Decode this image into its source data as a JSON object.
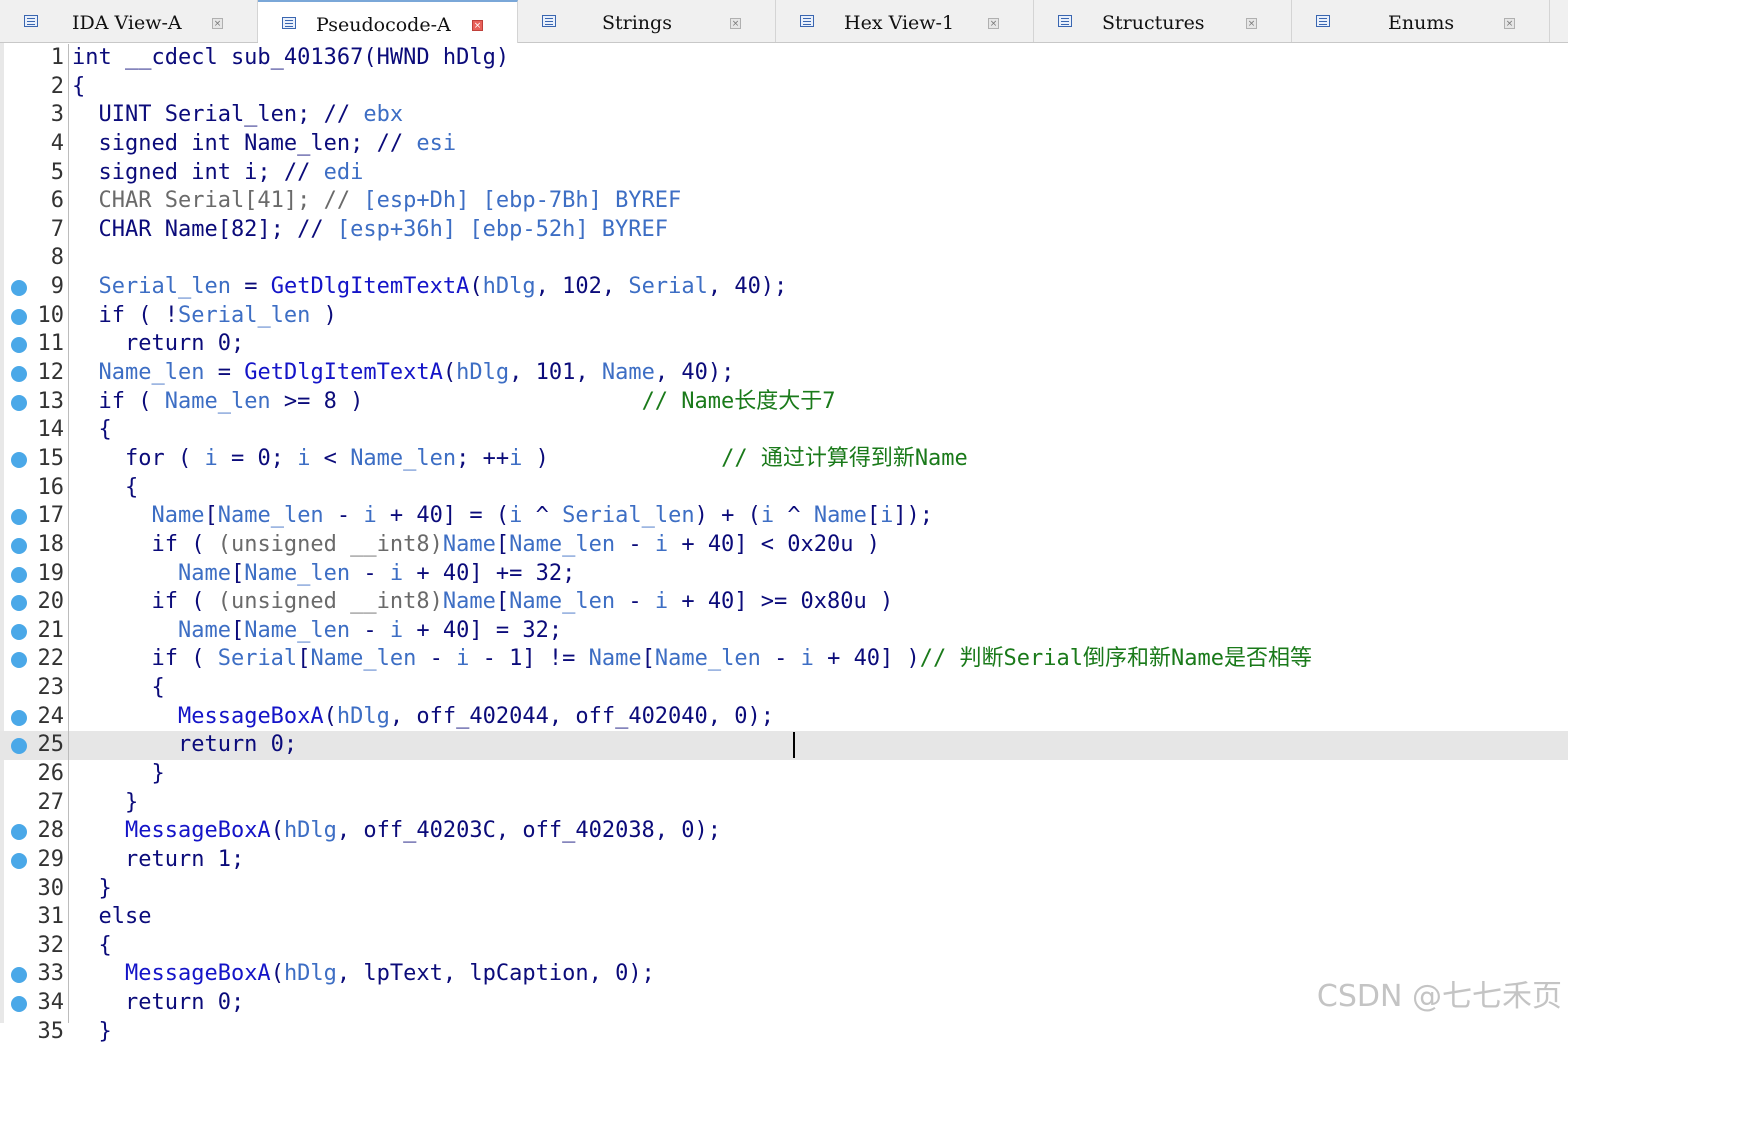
{
  "tabs": [
    {
      "label": "IDA View-A",
      "icon": "ida-view-icon",
      "active": false
    },
    {
      "label": "Pseudocode-A",
      "icon": "pseudocode-icon",
      "active": true
    },
    {
      "label": "Strings",
      "icon": "strings-icon",
      "active": false
    },
    {
      "label": "Hex View-1",
      "icon": "hex-view-icon",
      "active": false
    },
    {
      "label": "Structures",
      "icon": "structures-icon",
      "active": false
    },
    {
      "label": "Enums",
      "icon": "enums-icon",
      "active": false
    }
  ],
  "close_glyph": "×",
  "breakpoint_lines": [
    9,
    10,
    11,
    12,
    13,
    15,
    17,
    18,
    19,
    20,
    21,
    22,
    24,
    25,
    28,
    29,
    33,
    34
  ],
  "highlight_line": 25,
  "lines": [
    {
      "n": "1",
      "segs": [
        {
          "t": "int __cdecl sub_401367(HWND hDlg)",
          "k": ""
        }
      ]
    },
    {
      "n": "2",
      "segs": [
        {
          "t": "{",
          "k": ""
        }
      ]
    },
    {
      "n": "3",
      "segs": [
        {
          "t": "  UINT Serial_len; // ",
          "k": ""
        },
        {
          "t": "ebx",
          "k": "v"
        }
      ]
    },
    {
      "n": "4",
      "segs": [
        {
          "t": "  signed int Name_len; // ",
          "k": ""
        },
        {
          "t": "esi",
          "k": "v"
        }
      ]
    },
    {
      "n": "5",
      "segs": [
        {
          "t": "  signed int i; // ",
          "k": ""
        },
        {
          "t": "edi",
          "k": "v"
        }
      ]
    },
    {
      "n": "6",
      "segs": [
        {
          "t": "  CHAR Serial[41]; // ",
          "k": "d"
        },
        {
          "t": "[esp+Dh] [ebp-7Bh] BYREF",
          "k": "v"
        }
      ]
    },
    {
      "n": "7",
      "segs": [
        {
          "t": "  CHAR Name[82]; // ",
          "k": ""
        },
        {
          "t": "[esp+36h] [ebp-52h] BYREF",
          "k": "v"
        }
      ]
    },
    {
      "n": "8",
      "segs": [
        {
          "t": "",
          "k": ""
        }
      ]
    },
    {
      "n": "9",
      "segs": [
        {
          "t": "  ",
          "k": ""
        },
        {
          "t": "Serial_len",
          "k": "v"
        },
        {
          "t": " = ",
          "k": ""
        },
        {
          "t": "GetDlgItemTextA",
          "k": "f"
        },
        {
          "t": "(",
          "k": ""
        },
        {
          "t": "hDlg",
          "k": "v"
        },
        {
          "t": ", 102, ",
          "k": ""
        },
        {
          "t": "Serial",
          "k": "v"
        },
        {
          "t": ", 40);",
          "k": ""
        }
      ]
    },
    {
      "n": "10",
      "segs": [
        {
          "t": "  if ( !",
          "k": ""
        },
        {
          "t": "Serial_len",
          "k": "v"
        },
        {
          "t": " )",
          "k": ""
        }
      ]
    },
    {
      "n": "11",
      "segs": [
        {
          "t": "    return 0;",
          "k": ""
        }
      ]
    },
    {
      "n": "12",
      "segs": [
        {
          "t": "  ",
          "k": ""
        },
        {
          "t": "Name_len",
          "k": "v"
        },
        {
          "t": " = ",
          "k": ""
        },
        {
          "t": "GetDlgItemTextA",
          "k": "f"
        },
        {
          "t": "(",
          "k": ""
        },
        {
          "t": "hDlg",
          "k": "v"
        },
        {
          "t": ", 101, ",
          "k": ""
        },
        {
          "t": "Name",
          "k": "v"
        },
        {
          "t": ", 40);",
          "k": ""
        }
      ]
    },
    {
      "n": "13",
      "segs": [
        {
          "t": "  if ( ",
          "k": ""
        },
        {
          "t": "Name_len",
          "k": "v"
        },
        {
          "t": " >= 8 )                     ",
          "k": ""
        },
        {
          "t": "// Name长度大于7",
          "k": "c"
        }
      ]
    },
    {
      "n": "14",
      "segs": [
        {
          "t": "  {",
          "k": ""
        }
      ]
    },
    {
      "n": "15",
      "segs": [
        {
          "t": "    for ( ",
          "k": ""
        },
        {
          "t": "i",
          "k": "v"
        },
        {
          "t": " = 0; ",
          "k": ""
        },
        {
          "t": "i",
          "k": "v"
        },
        {
          "t": " < ",
          "k": ""
        },
        {
          "t": "Name_len",
          "k": "v"
        },
        {
          "t": "; ++",
          "k": ""
        },
        {
          "t": "i",
          "k": "v"
        },
        {
          "t": " )             ",
          "k": ""
        },
        {
          "t": "// 通过计算得到新Name",
          "k": "c"
        }
      ]
    },
    {
      "n": "16",
      "segs": [
        {
          "t": "    {",
          "k": ""
        }
      ]
    },
    {
      "n": "17",
      "segs": [
        {
          "t": "      ",
          "k": ""
        },
        {
          "t": "Name",
          "k": "v"
        },
        {
          "t": "[",
          "k": ""
        },
        {
          "t": "Name_len",
          "k": "v"
        },
        {
          "t": " - ",
          "k": ""
        },
        {
          "t": "i",
          "k": "v"
        },
        {
          "t": " + 40] = (",
          "k": ""
        },
        {
          "t": "i",
          "k": "v"
        },
        {
          "t": " ^ ",
          "k": ""
        },
        {
          "t": "Serial_len",
          "k": "v"
        },
        {
          "t": ") + (",
          "k": ""
        },
        {
          "t": "i",
          "k": "v"
        },
        {
          "t": " ^ ",
          "k": ""
        },
        {
          "t": "Name",
          "k": "v"
        },
        {
          "t": "[",
          "k": ""
        },
        {
          "t": "i",
          "k": "v"
        },
        {
          "t": "]);",
          "k": ""
        }
      ]
    },
    {
      "n": "18",
      "segs": [
        {
          "t": "      if ( ",
          "k": ""
        },
        {
          "t": "(unsigned __int8)",
          "k": "d"
        },
        {
          "t": "Name",
          "k": "v"
        },
        {
          "t": "[",
          "k": ""
        },
        {
          "t": "Name_len",
          "k": "v"
        },
        {
          "t": " - ",
          "k": ""
        },
        {
          "t": "i",
          "k": "v"
        },
        {
          "t": " + 40] < 0x20u )",
          "k": ""
        }
      ]
    },
    {
      "n": "19",
      "segs": [
        {
          "t": "        ",
          "k": ""
        },
        {
          "t": "Name",
          "k": "v"
        },
        {
          "t": "[",
          "k": ""
        },
        {
          "t": "Name_len",
          "k": "v"
        },
        {
          "t": " - ",
          "k": ""
        },
        {
          "t": "i",
          "k": "v"
        },
        {
          "t": " + 40] += 32;",
          "k": ""
        }
      ]
    },
    {
      "n": "20",
      "segs": [
        {
          "t": "      if ( ",
          "k": ""
        },
        {
          "t": "(unsigned __int8)",
          "k": "d"
        },
        {
          "t": "Name",
          "k": "v"
        },
        {
          "t": "[",
          "k": ""
        },
        {
          "t": "Name_len",
          "k": "v"
        },
        {
          "t": " - ",
          "k": ""
        },
        {
          "t": "i",
          "k": "v"
        },
        {
          "t": " + 40] >= 0x80u )",
          "k": ""
        }
      ]
    },
    {
      "n": "21",
      "segs": [
        {
          "t": "        ",
          "k": ""
        },
        {
          "t": "Name",
          "k": "v"
        },
        {
          "t": "[",
          "k": ""
        },
        {
          "t": "Name_len",
          "k": "v"
        },
        {
          "t": " - ",
          "k": ""
        },
        {
          "t": "i",
          "k": "v"
        },
        {
          "t": " + 40] = 32;",
          "k": ""
        }
      ]
    },
    {
      "n": "22",
      "segs": [
        {
          "t": "      if ( ",
          "k": ""
        },
        {
          "t": "Serial",
          "k": "v"
        },
        {
          "t": "[",
          "k": ""
        },
        {
          "t": "Name_len",
          "k": "v"
        },
        {
          "t": " - ",
          "k": ""
        },
        {
          "t": "i",
          "k": "v"
        },
        {
          "t": " - 1] != ",
          "k": ""
        },
        {
          "t": "Name",
          "k": "v"
        },
        {
          "t": "[",
          "k": ""
        },
        {
          "t": "Name_len",
          "k": "v"
        },
        {
          "t": " - ",
          "k": ""
        },
        {
          "t": "i",
          "k": "v"
        },
        {
          "t": " + 40] )",
          "k": ""
        },
        {
          "t": "// 判断Serial倒序和新Name是否相等",
          "k": "c"
        }
      ]
    },
    {
      "n": "23",
      "segs": [
        {
          "t": "      {",
          "k": ""
        }
      ]
    },
    {
      "n": "24",
      "segs": [
        {
          "t": "        ",
          "k": ""
        },
        {
          "t": "MessageBoxA",
          "k": "f"
        },
        {
          "t": "(",
          "k": ""
        },
        {
          "t": "hDlg",
          "k": "v"
        },
        {
          "t": ", off_402044, off_402040, 0);",
          "k": ""
        }
      ]
    },
    {
      "n": "25",
      "segs": [
        {
          "t": "        return 0;",
          "k": ""
        }
      ]
    },
    {
      "n": "26",
      "segs": [
        {
          "t": "      }",
          "k": ""
        }
      ]
    },
    {
      "n": "27",
      "segs": [
        {
          "t": "    }",
          "k": ""
        }
      ]
    },
    {
      "n": "28",
      "segs": [
        {
          "t": "    ",
          "k": ""
        },
        {
          "t": "MessageBoxA",
          "k": "f"
        },
        {
          "t": "(",
          "k": ""
        },
        {
          "t": "hDlg",
          "k": "v"
        },
        {
          "t": ", off_40203C, off_402038, 0);",
          "k": ""
        }
      ]
    },
    {
      "n": "29",
      "segs": [
        {
          "t": "    return 1;",
          "k": ""
        }
      ]
    },
    {
      "n": "30",
      "segs": [
        {
          "t": "  }",
          "k": ""
        }
      ]
    },
    {
      "n": "31",
      "segs": [
        {
          "t": "  else",
          "k": ""
        }
      ]
    },
    {
      "n": "32",
      "segs": [
        {
          "t": "  {",
          "k": ""
        }
      ]
    },
    {
      "n": "33",
      "segs": [
        {
          "t": "    ",
          "k": ""
        },
        {
          "t": "MessageBoxA",
          "k": "f"
        },
        {
          "t": "(",
          "k": ""
        },
        {
          "t": "hDlg",
          "k": "v"
        },
        {
          "t": ", lpText, lpCaption, 0);",
          "k": ""
        }
      ]
    },
    {
      "n": "34",
      "segs": [
        {
          "t": "    return 0;",
          "k": ""
        }
      ]
    },
    {
      "n": "35",
      "segs": [
        {
          "t": "  }",
          "k": ""
        }
      ]
    }
  ],
  "watermark": "CSDN @七七禾页"
}
